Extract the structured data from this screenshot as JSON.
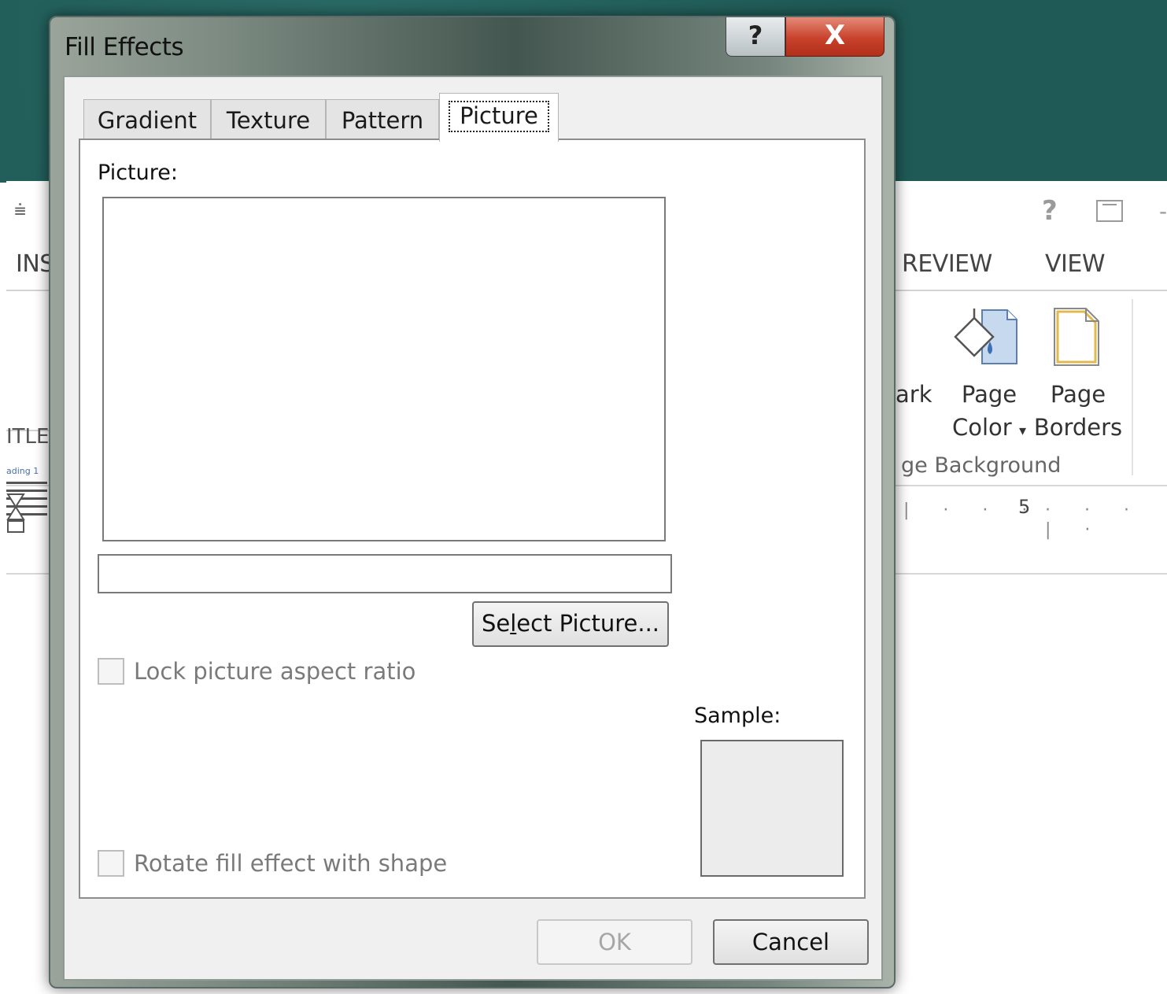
{
  "dialog": {
    "title": "Fill Effects",
    "help_glyph": "?",
    "close_glyph": "X",
    "tabs": [
      {
        "label": "Gradient",
        "active": false
      },
      {
        "label": "Texture",
        "active": false
      },
      {
        "label": "Pattern",
        "active": false
      },
      {
        "label": "Picture",
        "active": true
      }
    ],
    "picture_label": "Picture:",
    "picture_path_value": "",
    "select_picture_button": {
      "pre": "Se",
      "mnemonic": "l",
      "post": "ect Picture..."
    },
    "lock_aspect": {
      "label": "Lock picture aspect ratio",
      "checked": false,
      "enabled": false
    },
    "rotate_fill": {
      "label": "Rotate fill effect with shape",
      "checked": false,
      "enabled": false
    },
    "sample_label": "Sample:",
    "ok_button": {
      "label": "OK",
      "enabled": false
    },
    "cancel_button": {
      "label": "Cancel",
      "enabled": true
    }
  },
  "background_app": {
    "qat_glyph": "⩧",
    "help_glyph": "?",
    "ribbon_tabs": {
      "left_partial": "INS",
      "review": "REVIEW",
      "view": "VIEW"
    },
    "styles_gallery": {
      "title_partial": "ITLE",
      "heading_partial": "ading 1"
    },
    "watermark_partial": "ark",
    "page_color": {
      "line1": "Page",
      "line2": "Color",
      "dropdown_glyph": "▾"
    },
    "page_borders": {
      "line1": "Page",
      "line2": "Borders"
    },
    "group_label_partial": "ge Background",
    "ruler_number": "5",
    "icons": [
      "paint-bucket-icon",
      "page-border-icon"
    ]
  }
}
